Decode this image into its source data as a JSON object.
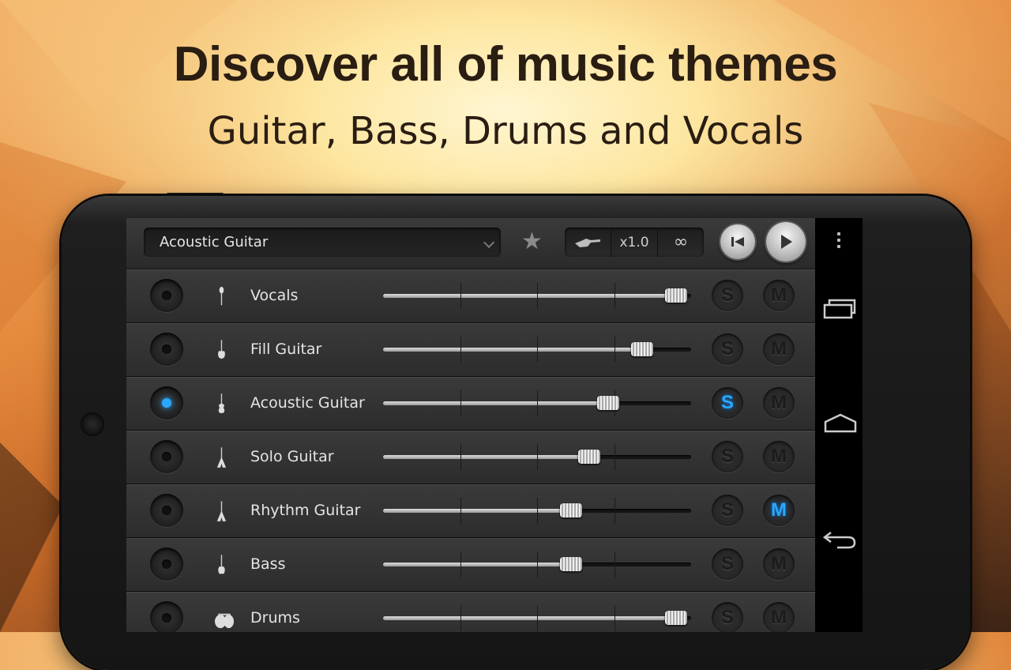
{
  "promo": {
    "headline": "Discover all of music themes",
    "subheadline": "Guitar, Bass, Drums and Vocals"
  },
  "toolbar": {
    "selected_track": "Acoustic Guitar",
    "speed_label": "x1.0",
    "loop_icon": "infinity-icon",
    "favorite_icon": "star-icon",
    "instrument_icon": "guitar-icon"
  },
  "tracks": [
    {
      "name": "Vocals",
      "record": false,
      "volume": 0.95,
      "solo": false,
      "mute": false,
      "icon": "microphone-icon"
    },
    {
      "name": "Fill Guitar",
      "record": false,
      "volume": 0.84,
      "solo": false,
      "mute": false,
      "icon": "electric-guitar-icon"
    },
    {
      "name": "Acoustic Guitar",
      "record": true,
      "volume": 0.73,
      "solo": true,
      "mute": false,
      "icon": "acoustic-guitar-icon"
    },
    {
      "name": "Solo Guitar",
      "record": false,
      "volume": 0.67,
      "solo": false,
      "mute": false,
      "icon": "flying-v-guitar-icon"
    },
    {
      "name": "Rhythm Guitar",
      "record": false,
      "volume": 0.61,
      "solo": false,
      "mute": true,
      "icon": "flying-v-guitar-icon"
    },
    {
      "name": "Bass",
      "record": false,
      "volume": 0.61,
      "solo": false,
      "mute": false,
      "icon": "bass-guitar-icon"
    },
    {
      "name": "Drums",
      "record": false,
      "volume": 0.95,
      "solo": false,
      "mute": false,
      "icon": "drum-kit-icon"
    }
  ],
  "buttons": {
    "solo_label": "S",
    "mute_label": "M"
  },
  "colors": {
    "active_blue": "#2aa8ff",
    "heading_text": "#2a1d12"
  }
}
